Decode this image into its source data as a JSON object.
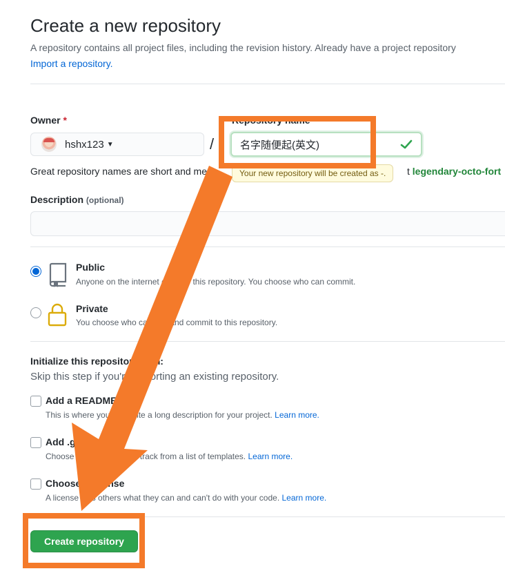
{
  "header": {
    "title": "Create a new repository",
    "subtitle": "A repository contains all project files, including the revision history. Already have a project repository",
    "import_link": "Import a repository."
  },
  "owner": {
    "label": "Owner",
    "required_mark": "*",
    "value": "hshx123"
  },
  "repo_name": {
    "label": "Repository name",
    "value": "名字随便起(英文)",
    "slash": "/"
  },
  "tooltip": "Your new repository will be created as -.",
  "name_hint": {
    "text": "Great repository names are short and mem",
    "rest_prefix": "t",
    "suggestion": "legendary-octo-fort"
  },
  "description": {
    "label": "Description",
    "optional": "(optional)",
    "value": ""
  },
  "visibility": [
    {
      "title": "Public",
      "note": "Anyone on the internet can see this repository. You choose who can commit.",
      "checked": true,
      "icon": "repo-icon"
    },
    {
      "title": "Private",
      "note": "You choose who can see and commit to this repository.",
      "checked": false,
      "icon": "lock-icon"
    }
  ],
  "initialize": {
    "title": "Initialize this repository with:",
    "subtitle": "Skip this step if you're importing an existing repository.",
    "options": [
      {
        "title": "Add a README file",
        "note": "This is where you can write a long description for your project.",
        "link": "Learn more."
      },
      {
        "title": "Add .gitignore",
        "note": "Choose which files not to track from a list of templates.",
        "link": "Learn more."
      },
      {
        "title": "Choose a license",
        "note": "A license tells others what they can and can't do with your code.",
        "link": "Learn more."
      }
    ]
  },
  "create_button": "Create repository",
  "colors": {
    "primary_button": "#2ea44f",
    "link": "#0366d6",
    "annotation": "#f47a2a",
    "valid_check": "#2ea44f"
  }
}
